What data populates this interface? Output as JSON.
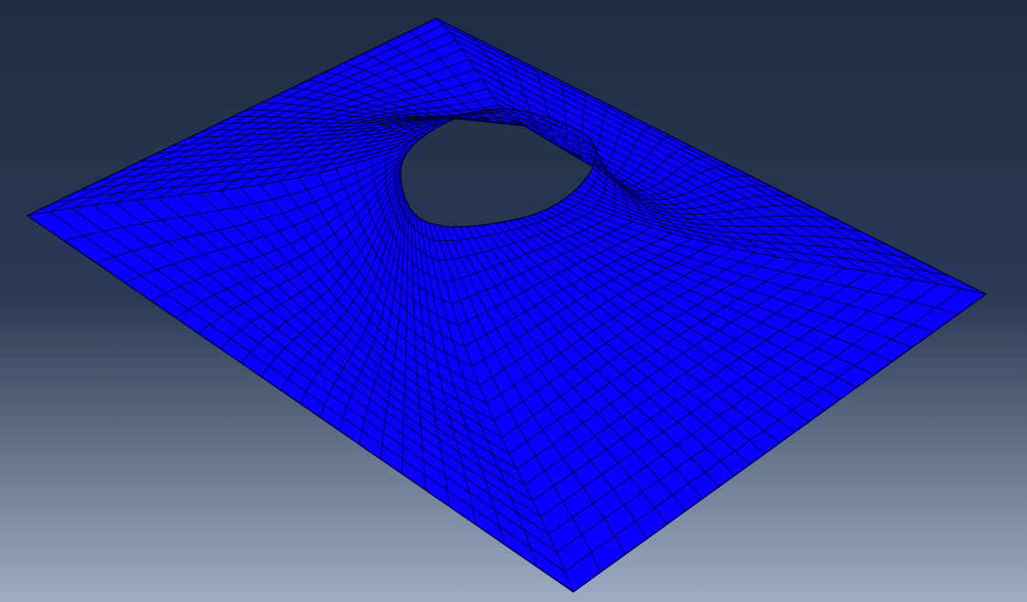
{
  "viewport": {
    "background_top": "#1f2c45",
    "background_mid": "#2b3b55",
    "background_bottom": "#9eadc4"
  },
  "model": {
    "name": "mesh-plate-with-hole",
    "fill_color": "#0a00ff",
    "edge_color": "#000033",
    "rings": 20,
    "spokes": 88,
    "hole_radius": 0.18,
    "warp_amplitude": 0.22
  }
}
